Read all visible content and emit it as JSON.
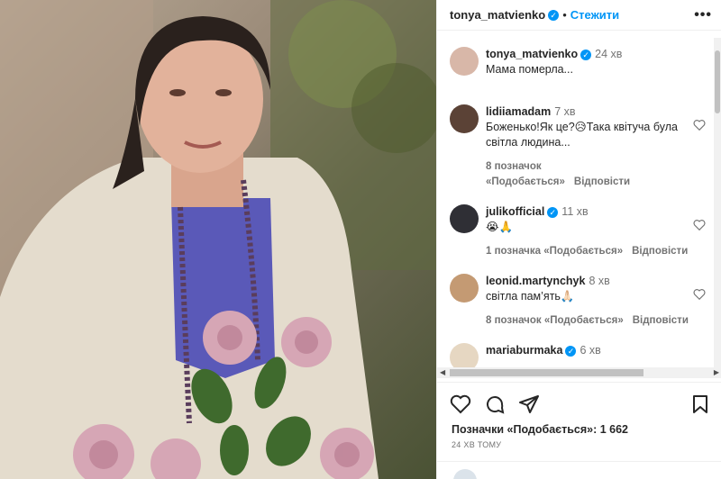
{
  "post": {
    "username": "tonya_matvienko",
    "follow_label": "Стежити",
    "more_label": "•••",
    "separator": "•"
  },
  "comments": [
    {
      "username": "tonya_matvienko",
      "verified": true,
      "time": "24 хв",
      "text": "Мама померла...",
      "likes": "",
      "reply": "",
      "avatar_color": "#d8b7a8"
    },
    {
      "username": "lidiiamadam",
      "verified": false,
      "time": "7 хв",
      "text": "Боженько!Як це?😥Така квітуча була світла людина...",
      "likes": "8 позначок «Подобається»",
      "reply": "Відповісти",
      "avatar_color": "#5b4236"
    },
    {
      "username": "julikofficial",
      "verified": true,
      "time": "11 хв",
      "text": "😭🙏",
      "likes": "1 позначка «Подобається»",
      "reply": "Відповісти",
      "avatar_color": "#2f2f35"
    },
    {
      "username": "leonid.martynchyk",
      "verified": false,
      "time": "8 хв",
      "text": "світла пам’ять🙏🏻",
      "likes": "8 позначок «Подобається»",
      "reply": "Відповісти",
      "avatar_color": "#c49a73"
    },
    {
      "username": "mariaburmaka",
      "verified": true,
      "time": "6 хв",
      "text": "",
      "likes": "",
      "reply": "",
      "avatar_color": "#e6d7c2"
    }
  ],
  "footer": {
    "likes_count": "Позначки «Подобається»: 1 662",
    "time_ago": "24 ХВ ТОМУ"
  },
  "icons": [
    "heart-icon",
    "comment-icon",
    "share-icon",
    "bookmark-icon",
    "verified-icon",
    "more-icon"
  ],
  "colors": {
    "accent": "#0095f6",
    "muted": "#737373",
    "text": "#262626"
  }
}
